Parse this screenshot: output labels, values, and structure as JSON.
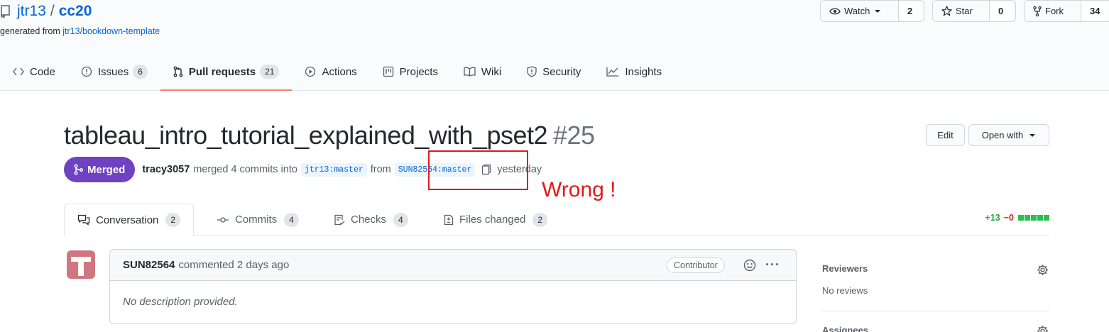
{
  "repo": {
    "owner": "jtr13",
    "separator": "/",
    "name": "cc20",
    "generated_prefix": "generated from ",
    "template_link": "jtr13/bookdown-template"
  },
  "actions": {
    "watch_label": "Watch",
    "watch_count": "2",
    "star_label": "Star",
    "star_count": "0",
    "fork_label": "Fork",
    "fork_count": "34"
  },
  "nav": {
    "tabs": [
      {
        "label": "Code",
        "icon": "code-icon"
      },
      {
        "label": "Issues",
        "count": "6",
        "icon": "issue-icon"
      },
      {
        "label": "Pull requests",
        "count": "21",
        "icon": "pull-request-icon",
        "active": true
      },
      {
        "label": "Actions",
        "icon": "play-icon"
      },
      {
        "label": "Projects",
        "icon": "project-icon"
      },
      {
        "label": "Wiki",
        "icon": "book-icon"
      },
      {
        "label": "Security",
        "icon": "shield-icon"
      },
      {
        "label": "Insights",
        "icon": "graph-icon"
      }
    ]
  },
  "pr": {
    "title": "tableau_intro_tutorial_explained_with_pset2",
    "number": "#25",
    "edit_label": "Edit",
    "open_with_label": "Open with",
    "state": "Merged",
    "author": "tracy3057",
    "merged_text": "merged 4 commits into",
    "base_branch": "jtr13:master",
    "from_text": "from",
    "head_branch": "SUN82564:master",
    "time": "yesterday"
  },
  "annotation": {
    "text": "Wrong !",
    "color": "#e0191a"
  },
  "subtabs": {
    "items": [
      {
        "label": "Conversation",
        "count": "2",
        "icon": "comment-discussion-icon",
        "active": true
      },
      {
        "label": "Commits",
        "count": "4",
        "icon": "git-commit-icon"
      },
      {
        "label": "Checks",
        "count": "4",
        "icon": "checklist-icon"
      },
      {
        "label": "Files changed",
        "count": "2",
        "icon": "file-diff-icon"
      }
    ],
    "additions": "+13",
    "deletions": "−0"
  },
  "comment": {
    "author": "SUN82564",
    "meta": "commented 2 days ago",
    "role_label": "Contributor",
    "more": "···",
    "body": "No description provided."
  },
  "sidebar": {
    "reviewers_heading": "Reviewers",
    "reviewers_value": "No reviews",
    "assignees_heading": "Assignees"
  },
  "colors": {
    "merged": "#6f42c1",
    "link": "#0366d6",
    "tab_underline": "#f9826c",
    "additions": "#28a745",
    "deletions": "#cb2431"
  }
}
